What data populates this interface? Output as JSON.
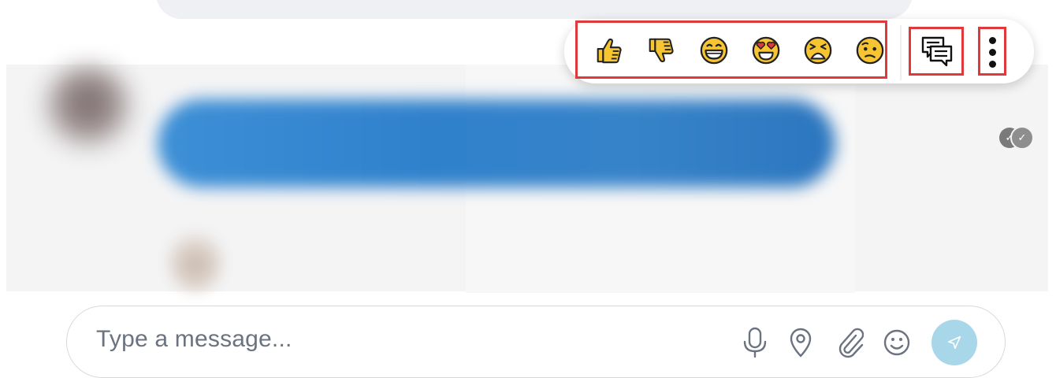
{
  "reactions": {
    "items": [
      {
        "name": "thumbs-up",
        "label": ""
      },
      {
        "name": "thumbs-down",
        "label": ""
      },
      {
        "name": "grinning",
        "label": ""
      },
      {
        "name": "heart-eyes",
        "label": ""
      },
      {
        "name": "weary",
        "label": ""
      },
      {
        "name": "confused",
        "label": ""
      }
    ],
    "thread_icon": "reply-in-thread-icon",
    "more_icon": "more-options-icon"
  },
  "composer": {
    "placeholder": "Type a message...",
    "icons": [
      "microphone-icon",
      "location-pin-icon",
      "paperclip-icon",
      "smiley-icon",
      "send-icon"
    ]
  },
  "message": {
    "status_icon": "read-receipt-icon"
  },
  "colors": {
    "highlight": "#e0393c",
    "send_button": "#a8d7ea",
    "emoji_yellow": "#f6c531"
  }
}
